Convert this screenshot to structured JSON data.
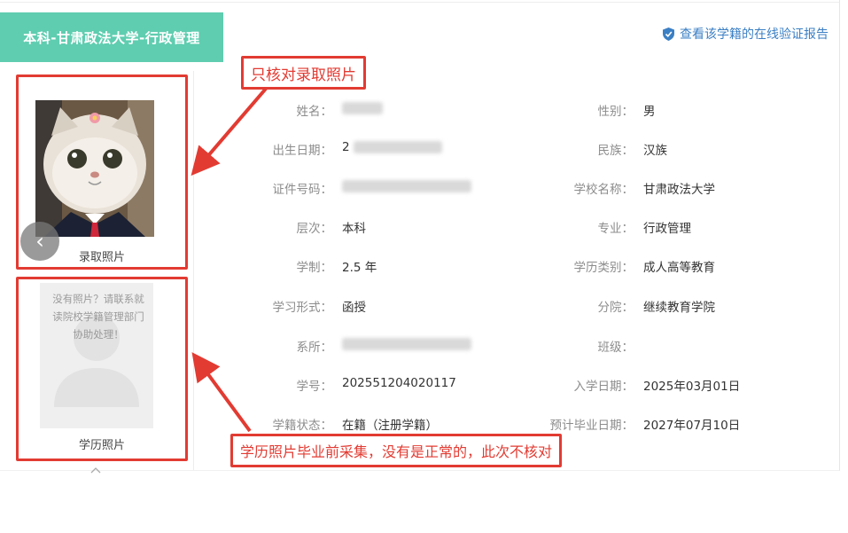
{
  "header": {
    "title": "本科-甘肃政法大学-行政管理",
    "verify_link": "查看该学籍的在线验证报告"
  },
  "photos": {
    "admission_label": "录取照片",
    "education_label": "学历照片",
    "no_photo_message": "没有照片？请联系就读院校学籍管理部门协助处理！"
  },
  "annotations": {
    "top": "只核对录取照片",
    "bottom": "学历照片毕业前采集，没有是正常的，此次不核对"
  },
  "fields": {
    "name_label": "姓名：",
    "gender_label": "性别：",
    "gender_value": "男",
    "birth_label": "出生日期：",
    "birth_value_partial": "2",
    "ethnicity_label": "民族：",
    "ethnicity_value": "汉族",
    "id_label": "证件号码：",
    "school_label": "学校名称：",
    "school_value": "甘肃政法大学",
    "level_label": "层次：",
    "level_value": "本科",
    "major_label": "专业：",
    "major_value": "行政管理",
    "duration_label": "学制：",
    "duration_value": "2.5 年",
    "category_label": "学历类别：",
    "category_value": "成人高等教育",
    "form_label": "学习形式：",
    "form_value": "函授",
    "branch_label": "分院：",
    "branch_value": "继续教育学院",
    "dept_label": "系所：",
    "class_label": "班级：",
    "student_no_label": "学号：",
    "student_no_value": "202551204020117",
    "enroll_label": "入学日期：",
    "enroll_value": "2025年03月01日",
    "status_label": "学籍状态：",
    "status_value": "在籍（注册学籍）",
    "grad_label": "预计毕业日期：",
    "grad_value": "2027年07月10日"
  },
  "colors": {
    "tab_bg": "#5fcdb0",
    "annotation_red": "#e23b32",
    "link_blue": "#3b7fc4"
  }
}
